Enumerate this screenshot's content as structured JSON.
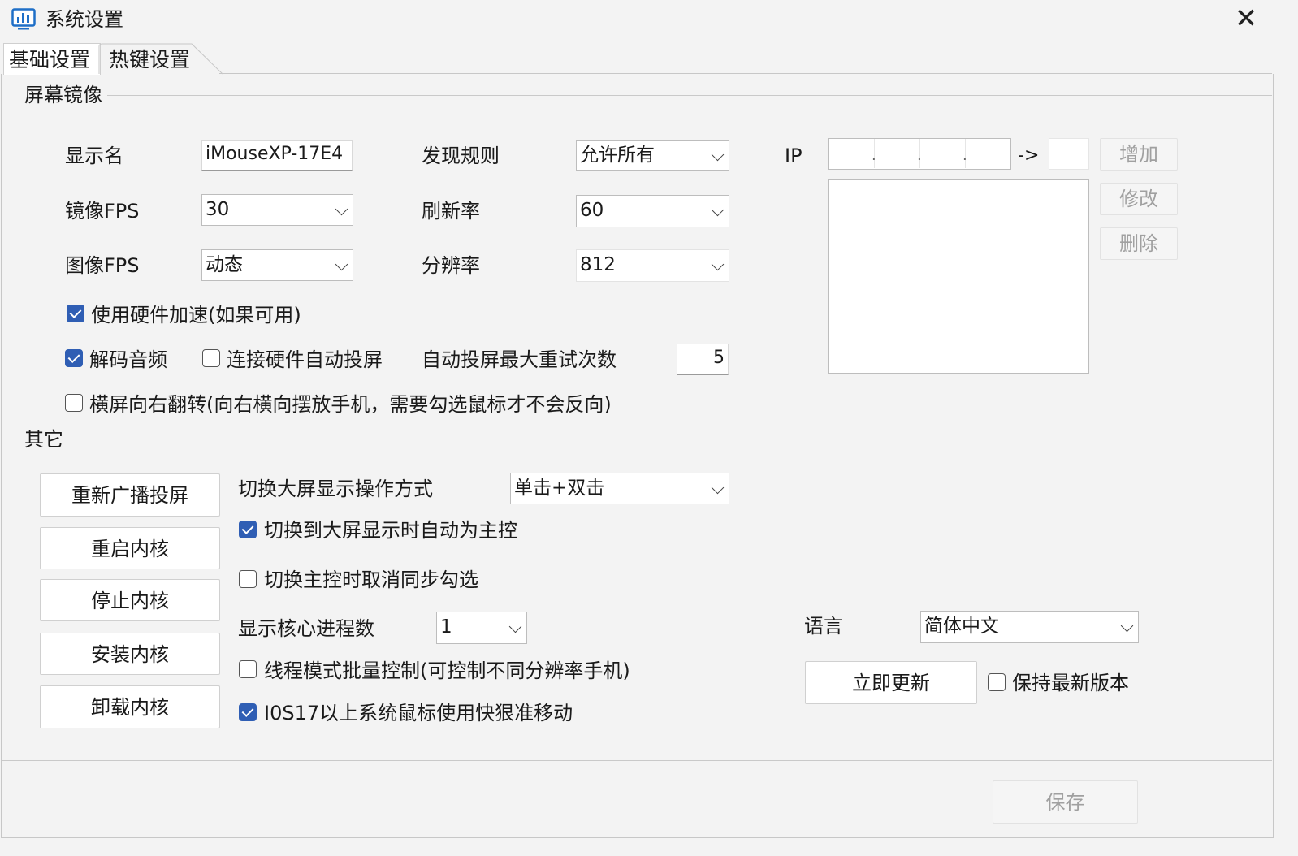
{
  "window": {
    "title": "系统设置",
    "close_glyph": "✕",
    "icon": "chart-monitor-icon"
  },
  "tabs": [
    {
      "label": "基础设置",
      "active": true
    },
    {
      "label": "热键设置",
      "active": false
    }
  ],
  "screen_mirror": {
    "title": "屏幕镜像",
    "display_name_label": "显示名",
    "display_name_value": "iMouseXP-17E4",
    "discovery_rule_label": "发现规则",
    "discovery_rule_value": "允许所有",
    "mirror_fps_label": "镜像FPS",
    "mirror_fps_value": "30",
    "refresh_rate_label": "刷新率",
    "refresh_rate_value": "60",
    "image_fps_label": "图像FPS",
    "image_fps_value": "动态",
    "resolution_label": "分辨率",
    "resolution_value": "812",
    "hardware_accel_label": "使用硬件加速(如果可用)",
    "hardware_accel_checked": true,
    "decode_audio_label": "解码音频",
    "decode_audio_checked": true,
    "auto_cast_label": "连接硬件自动投屏",
    "auto_cast_checked": false,
    "max_retry_label": "自动投屏最大重试次数",
    "max_retry_value": "5",
    "landscape_flip_label": "横屏向右翻转(向右横向摆放手机，需要勾选鼠标才不会反向)",
    "landscape_flip_checked": false,
    "ip_label": "IP",
    "ip_arrow": "->",
    "add_button": "增加",
    "modify_button": "修改",
    "delete_button": "删除"
  },
  "other": {
    "title": "其它",
    "rebroadcast_button": "重新广播投屏",
    "restart_kernel_button": "重启内核",
    "stop_kernel_button": "停止内核",
    "install_kernel_button": "安装内核",
    "uninstall_kernel_button": "卸载内核",
    "switch_mode_label": "切换大屏显示操作方式",
    "switch_mode_value": "单击+双击",
    "auto_master_label": "切换到大屏显示时自动为主控",
    "auto_master_checked": true,
    "cancel_sync_label": "切换主控时取消同步勾选",
    "cancel_sync_checked": false,
    "core_process_label": "显示核心进程数",
    "core_process_value": "1",
    "thread_mode_label": "线程模式批量控制(可控制不同分辨率手机)",
    "thread_mode_checked": false,
    "ios17_label": "I0S17以上系统鼠标使用快狠准移动",
    "ios17_checked": true,
    "language_label": "语言",
    "language_value": "简体中文",
    "update_button": "立即更新",
    "keep_latest_label": "保持最新版本",
    "keep_latest_checked": false
  },
  "footer": {
    "save_button": "保存"
  },
  "colors": {
    "accent": "#2f5eb4",
    "window_bg": "#f3f3f3",
    "app_icon": "#1f6fc7"
  }
}
